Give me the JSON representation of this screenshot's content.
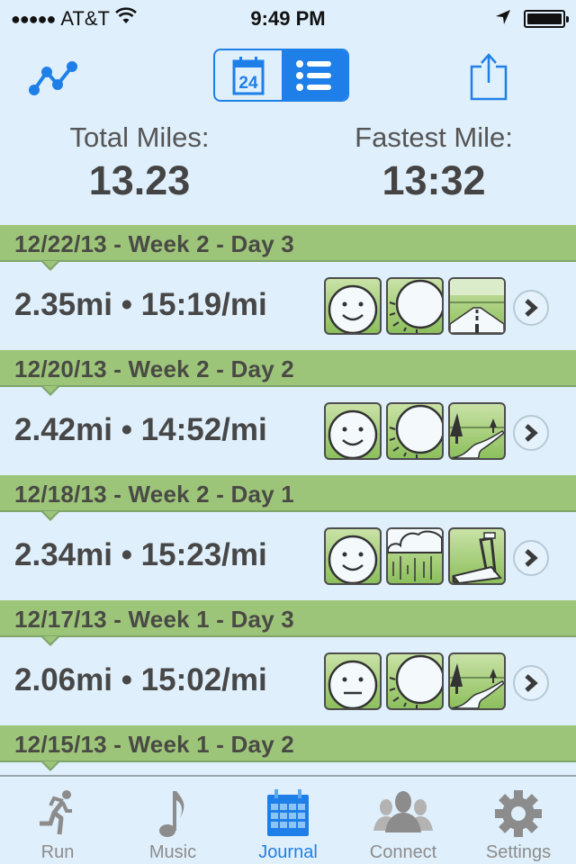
{
  "status_bar": {
    "carrier": "AT&T",
    "signal_dots": 5,
    "time": "9:49 PM",
    "location_icon": "location-arrow-icon",
    "battery_icon": "battery-full-icon",
    "battery_level": 1.0
  },
  "nav_bar": {
    "graph_icon": "graph-icon",
    "segmented": [
      {
        "name": "calendar-view",
        "icon": "calendar-icon",
        "day": "24",
        "active": false
      },
      {
        "name": "list-view",
        "icon": "list-icon",
        "active": true
      }
    ],
    "share_icon": "share-icon"
  },
  "summary": {
    "total_miles_label": "Total Miles:",
    "total_miles_value": "13.23",
    "fastest_mile_label": "Fastest Mile:",
    "fastest_mile_value": "13:32"
  },
  "entries": [
    {
      "header": "12/22/13 - Week 2 - Day 3",
      "stats": "2.35mi • 15:19/mi",
      "mood": "happy",
      "weather": "sunny",
      "terrain": "road"
    },
    {
      "header": "12/20/13 - Week 2 - Day 2",
      "stats": "2.42mi • 14:52/mi",
      "mood": "happy",
      "weather": "sunny",
      "terrain": "trail"
    },
    {
      "header": "12/18/13 - Week 2 - Day 1",
      "stats": "2.34mi • 15:23/mi",
      "mood": "happy",
      "weather": "rainy",
      "terrain": "treadmill"
    },
    {
      "header": "12/17/13 - Week 1 - Day 3",
      "stats": "2.06mi • 15:02/mi",
      "mood": "neutral",
      "weather": "sunny",
      "terrain": "trail"
    },
    {
      "header": "12/15/13 - Week 1 - Day 2",
      "stats": "",
      "mood": "",
      "weather": "",
      "terrain": ""
    }
  ],
  "tab_bar": {
    "tabs": [
      {
        "label": "Run",
        "icon": "runner-icon",
        "active": false
      },
      {
        "label": "Music",
        "icon": "music-note-icon",
        "active": false
      },
      {
        "label": "Journal",
        "icon": "calendar-grid-icon",
        "active": true
      },
      {
        "label": "Connect",
        "icon": "people-icon",
        "active": false
      },
      {
        "label": "Settings",
        "icon": "gear-icon",
        "active": false
      }
    ]
  },
  "colors": {
    "accent": "#1f7fe8",
    "background": "#dfeffb",
    "header_green": "#9dc57a",
    "text_dark": "#444444",
    "tab_inactive": "#8c8c8c"
  }
}
